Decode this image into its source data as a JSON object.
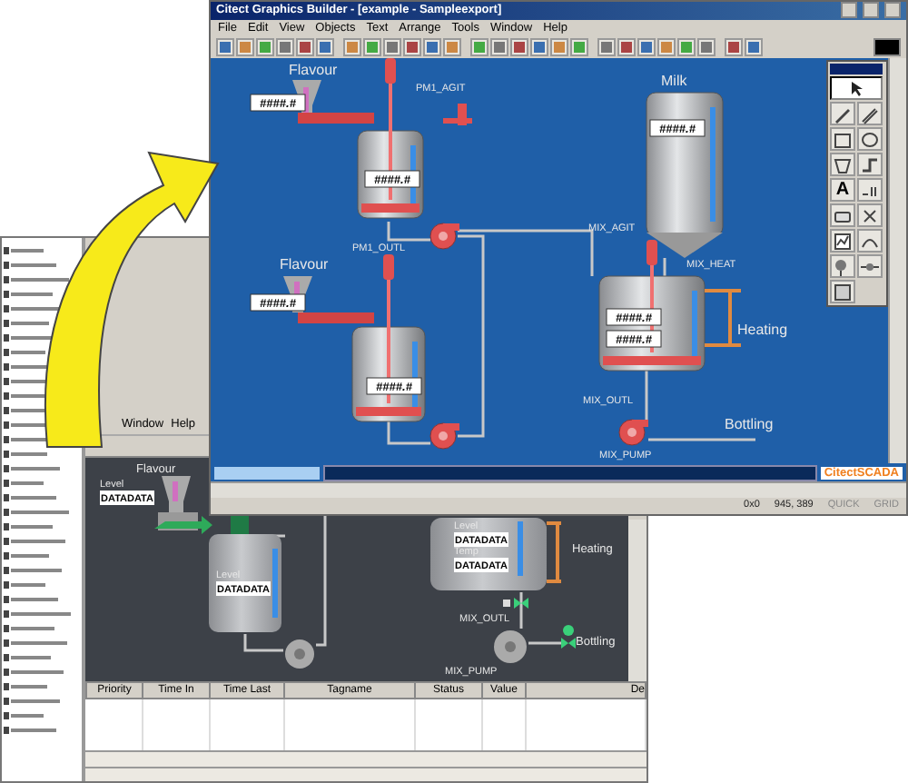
{
  "front_window": {
    "title": "Citect Graphics Builder - [example - Sampleexport]",
    "menus": [
      "File",
      "Edit",
      "View",
      "Objects",
      "Text",
      "Arrange",
      "Tools",
      "Window",
      "Help"
    ],
    "section_labels": [
      "Flavour",
      "Milk",
      "Flavour",
      "Heating",
      "Bottling"
    ],
    "displays": [
      "####.#",
      "####.#",
      "####.#",
      "####.#",
      "####.#",
      "####.#",
      "####.#"
    ],
    "tag_labels": [
      "PM1_AGIT",
      "PM1_OUTL",
      "MIX_AGIT",
      "MIX_HEAT",
      "MIX_OUTL",
      "MIX_PUMP"
    ],
    "tools": [
      {
        "kind": "pointer",
        "selected": true
      },
      {
        "kind": "pen",
        "selected": false
      },
      {
        "kind": "pencil",
        "selected": false
      },
      {
        "kind": "rect",
        "selected": false
      },
      {
        "kind": "ellipse",
        "selected": false
      },
      {
        "kind": "polygon",
        "selected": false
      },
      {
        "kind": "pipe",
        "selected": false
      },
      {
        "kind": "text",
        "label": "A",
        "selected": false
      },
      {
        "kind": "number",
        "selected": false
      },
      {
        "kind": "button",
        "selected": false
      },
      {
        "kind": "symbol",
        "selected": false
      },
      {
        "kind": "trend",
        "selected": false
      },
      {
        "kind": "gauge",
        "selected": false
      },
      {
        "kind": "genie",
        "selected": false
      },
      {
        "kind": "bitmap",
        "selected": false
      },
      {
        "kind": "group",
        "selected": false
      }
    ],
    "logo": "CitectSCADA",
    "status": [
      "0x0",
      "945, 389",
      "QUICK",
      "GRID"
    ]
  },
  "back_window": {
    "menus": [
      "Window",
      "Help"
    ],
    "labels": [
      "Flavour",
      "Level",
      "Level",
      "Level",
      "Temp",
      "Heating",
      "MIX_OUTL",
      "Bottling",
      "MIX_PUMP"
    ],
    "displays": [
      "DATADATA",
      "DATADATA",
      "DATADATA",
      "DATADATA"
    ],
    "table": {
      "columns": [
        "Priority",
        "Time In",
        "Time Last",
        "Tagname",
        "Status",
        "Value",
        "De"
      ]
    }
  }
}
